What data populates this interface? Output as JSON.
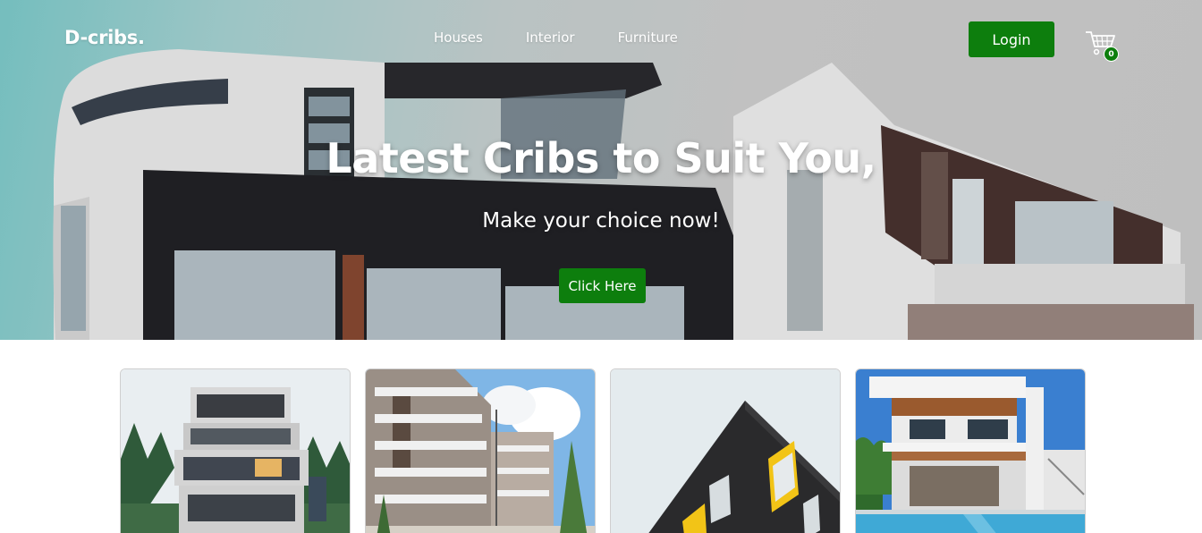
{
  "brand": {
    "logo": "D-cribs."
  },
  "nav": {
    "items": [
      "Houses",
      "Interior",
      "Furniture"
    ]
  },
  "header": {
    "login_label": "Login",
    "cart_count": "0"
  },
  "hero": {
    "title": "Latest Cribs to Suit You,",
    "subtitle": "Make your choice now!",
    "cta_label": "Click Here"
  },
  "colors": {
    "accent": "#0d7e0d",
    "text_light": "#ffffff"
  },
  "icons": {
    "cart": "cart-icon"
  },
  "cards": [
    {
      "image": "modern-house-forest"
    },
    {
      "image": "apartment-complex"
    },
    {
      "image": "dark-corner-building"
    },
    {
      "image": "villa-with-pool"
    }
  ]
}
